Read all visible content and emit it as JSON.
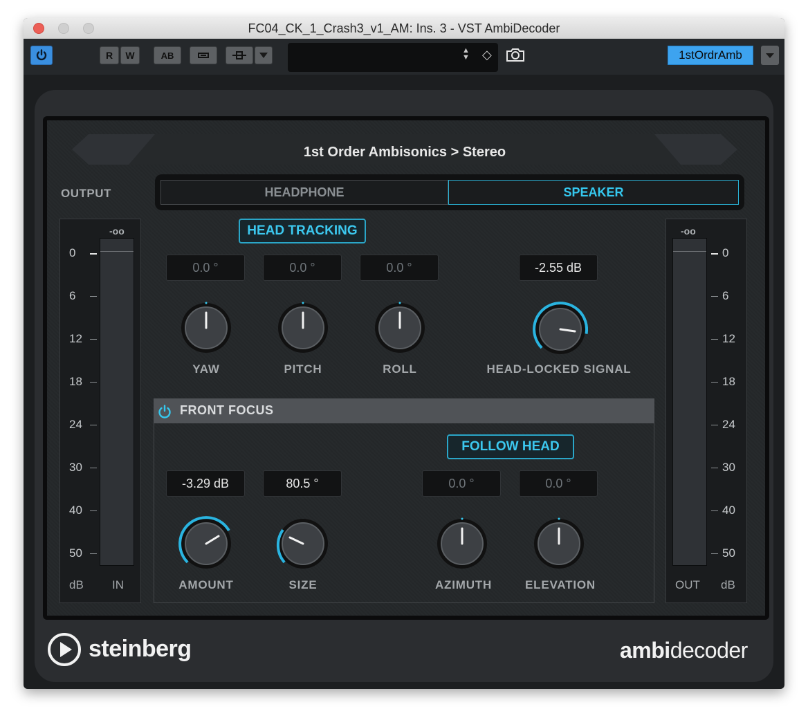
{
  "window": {
    "title": "FC04_CK_1_Crash3_v1_AM: Ins. 3 - VST AmbiDecoder"
  },
  "toolbar": {
    "read_label": "R",
    "write_label": "W",
    "ab_label": "AB",
    "preset_name": "1stOrdrAmb",
    "preset_value": ""
  },
  "plugin": {
    "format_title": "1st Order Ambisonics > Stereo",
    "output_label": "OUTPUT",
    "mode": {
      "headphone_label": "HEADPHONE",
      "speaker_label": "SPEAKER",
      "active": "SPEAKER"
    },
    "head_tracking_label": "HEAD TRACKING",
    "yaw": {
      "label": "YAW",
      "value": "0.0 °"
    },
    "pitch": {
      "label": "PITCH",
      "value": "0.0 °"
    },
    "roll": {
      "label": "ROLL",
      "value": "0.0 °"
    },
    "head_locked": {
      "label": "HEAD-LOCKED SIGNAL",
      "value": "-2.55 dB"
    },
    "front_focus": {
      "title": "FRONT FOCUS",
      "follow_head_label": "FOLLOW HEAD",
      "amount": {
        "label": "AMOUNT",
        "value": "-3.29 dB"
      },
      "size": {
        "label": "SIZE",
        "value": "80.5 °"
      },
      "azimuth": {
        "label": "AZIMUTH",
        "value": "0.0 °"
      },
      "elevation": {
        "label": "ELEVATION",
        "value": "0.0 °"
      }
    },
    "meter_in": {
      "peak": "-oo",
      "unit": "dB",
      "name": "IN"
    },
    "meter_out": {
      "peak": "-oo",
      "unit": "dB",
      "name": "OUT"
    },
    "meter_scale": [
      "0",
      "6",
      "12",
      "18",
      "24",
      "30",
      "40",
      "50"
    ],
    "brand": "steinberg",
    "product_bold": "ambi",
    "product_light": "decoder"
  },
  "colors": {
    "accent": "#35c8ef",
    "power_button": "#3a8fe0",
    "preset_badge": "#3da3ef"
  }
}
